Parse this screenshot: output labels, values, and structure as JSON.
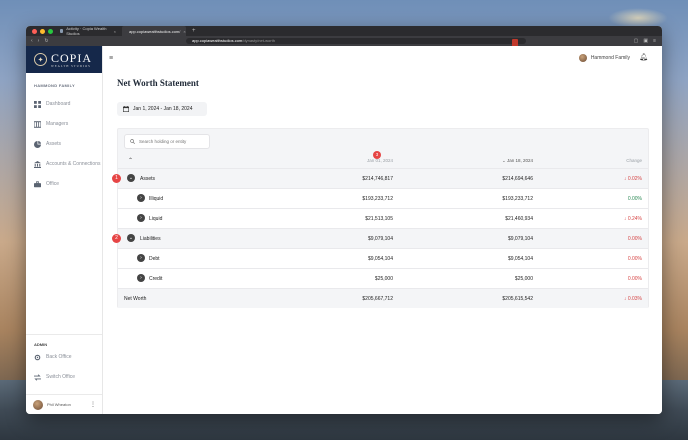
{
  "browser": {
    "tabs": [
      {
        "label": "Activity · Copia Wealth Studios"
      },
      {
        "label": "app.copiawealthstudios.com/"
      }
    ],
    "url_host": "app.copiawealthstudios.com",
    "url_path": "/dynasty/net-worth"
  },
  "brand": {
    "name": "COPIA",
    "subtitle": "WEALTH STUDIOS"
  },
  "sidebar": {
    "family_label": "HAMMOND FAMILY",
    "items": [
      {
        "label": "Dashboard",
        "icon": "grid-icon"
      },
      {
        "label": "Managers",
        "icon": "columns-icon"
      },
      {
        "label": "Assets",
        "icon": "pie-icon"
      },
      {
        "label": "Accounts & Connections",
        "icon": "bank-icon"
      },
      {
        "label": "Office",
        "icon": "briefcase-icon"
      }
    ],
    "admin_label": "ADMIN",
    "admin_items": [
      {
        "label": "Back Office",
        "icon": "gear-icon"
      },
      {
        "label": "Switch Office",
        "icon": "switch-icon"
      }
    ],
    "user_name": "Phil Wheaton"
  },
  "header": {
    "family_button": "Hammond Family"
  },
  "page": {
    "title": "Net Worth Statement",
    "date_range": "Jan 1, 2024 - Jan 18, 2024"
  },
  "table": {
    "search_placeholder": "Search holding or entity",
    "columns": {
      "date1": "Jan 01, 2024",
      "date2": "Jan 18, 2024",
      "change": "Change"
    },
    "header_badge": "3",
    "rows": [
      {
        "label": "Assets",
        "v1": "$214,746,817",
        "v2": "$214,694,646",
        "change": "0.02%"
      },
      {
        "label": "Illiquid",
        "v1": "$193,233,712",
        "v2": "$193,233,712",
        "change": "0.00%"
      },
      {
        "label": "Liquid",
        "v1": "$21,513,105",
        "v2": "$21,460,934",
        "change": "0.24%"
      },
      {
        "label": "Liabilities",
        "v1": "$9,079,104",
        "v2": "$9,079,104",
        "change": "0.00%"
      },
      {
        "label": "Debt",
        "v1": "$9,054,104",
        "v2": "$9,054,104",
        "change": "0.00%"
      },
      {
        "label": "Credit",
        "v1": "$25,000",
        "v2": "$25,000",
        "change": "0.00%"
      },
      {
        "label": "Net Worth",
        "v1": "$205,667,712",
        "v2": "$205,615,542",
        "change": "0.03%"
      }
    ],
    "row_badges": [
      "1",
      "2"
    ]
  },
  "colors": {
    "accent": "#15284a",
    "negative": "#d64545",
    "positive": "#2f8a57",
    "badge": "#e64545"
  }
}
